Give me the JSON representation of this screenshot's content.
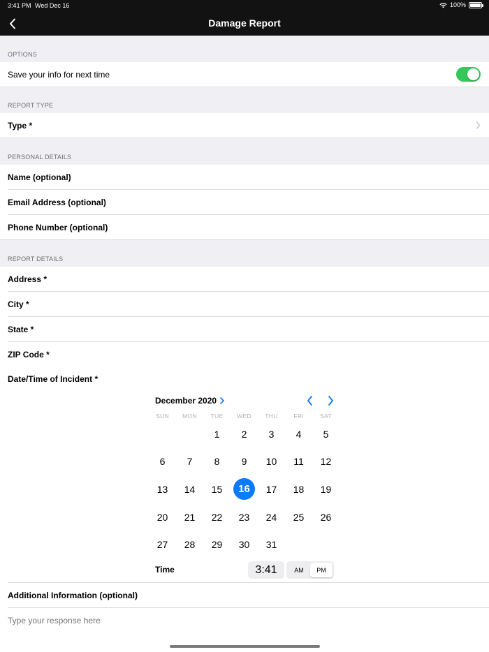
{
  "status": {
    "time": "3:41 PM",
    "date": "Wed Dec 16",
    "battery": "100%"
  },
  "nav": {
    "title": "Damage Report",
    "back_icon": "chevron-left-icon"
  },
  "sections": {
    "options": "OPTIONS",
    "report_type": "REPORT TYPE",
    "personal": "PERSONAL DETAILS",
    "report_details": "REPORT DETAILS"
  },
  "options": {
    "save_info_label": "Save your info for next time",
    "save_info_on": true
  },
  "report_type": {
    "type_label": "Type *"
  },
  "personal": {
    "name": "Name (optional)",
    "email": "Email Address (optional)",
    "phone": "Phone Number (optional)"
  },
  "details": {
    "address": "Address *",
    "city": "City *",
    "state": "State *",
    "zip": "ZIP Code *",
    "datetime": "Date/Time of Incident *"
  },
  "calendar": {
    "month": "December 2020",
    "weekdays": [
      "SUN",
      "MON",
      "TUE",
      "WED",
      "THU",
      "FRI",
      "SAT"
    ],
    "weeks": [
      [
        "",
        "",
        "1",
        "2",
        "3",
        "4",
        "5"
      ],
      [
        "6",
        "7",
        "8",
        "9",
        "10",
        "11",
        "12"
      ],
      [
        "13",
        "14",
        "15",
        "16",
        "17",
        "18",
        "19"
      ],
      [
        "20",
        "21",
        "22",
        "23",
        "24",
        "25",
        "26"
      ],
      [
        "27",
        "28",
        "29",
        "30",
        "31",
        "",
        ""
      ]
    ],
    "selected_day": "16",
    "time_label": "Time",
    "time_value": "3:41",
    "am": "AM",
    "pm": "PM",
    "period": "PM"
  },
  "additional": {
    "label": "Additional Information (optional)",
    "placeholder": "Type your response here"
  },
  "colors": {
    "accent": "#0a7aff",
    "toggle_on": "#34c759",
    "bar": "#121212",
    "group_bg": "#efeff4"
  }
}
